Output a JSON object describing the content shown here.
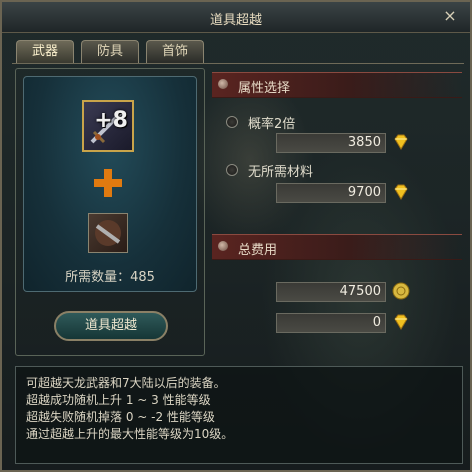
{
  "window": {
    "title": "道具超越",
    "close_glyph": "×"
  },
  "tabs": [
    {
      "label": "武器",
      "active": true
    },
    {
      "label": "防具",
      "active": false
    },
    {
      "label": "首饰",
      "active": false
    }
  ],
  "item": {
    "level": "+8",
    "icon": "weapon-icon"
  },
  "material": {
    "icon": "material-icon",
    "required_count": "所需数量：485"
  },
  "action_button": "道具超越",
  "attribute_section": {
    "title": "属性选择",
    "options": [
      {
        "label": "概率2倍",
        "value": "3850",
        "currency_icon": "diamond-icon"
      },
      {
        "label": "无所需材料",
        "value": "9700",
        "currency_icon": "diamond-icon"
      }
    ]
  },
  "cost_section": {
    "title": "总费用",
    "rows": [
      {
        "value": "47500",
        "currency_icon": "gold-coin-icon"
      },
      {
        "value": "0",
        "currency_icon": "diamond-icon"
      }
    ]
  },
  "description": [
    "可超越天龙武器和7大陆以后的装备。",
    "超越成功随机上升 1 ~ 3 性能等级",
    "超越失败随机掉落 0 ~ -2 性能等级",
    "通过超越上升的最大性能等级为10级。"
  ],
  "colors": {
    "accent_gold": "#c9a44a",
    "plus_orange": "#e07a10",
    "diamond_yellow": "#f0c020"
  }
}
